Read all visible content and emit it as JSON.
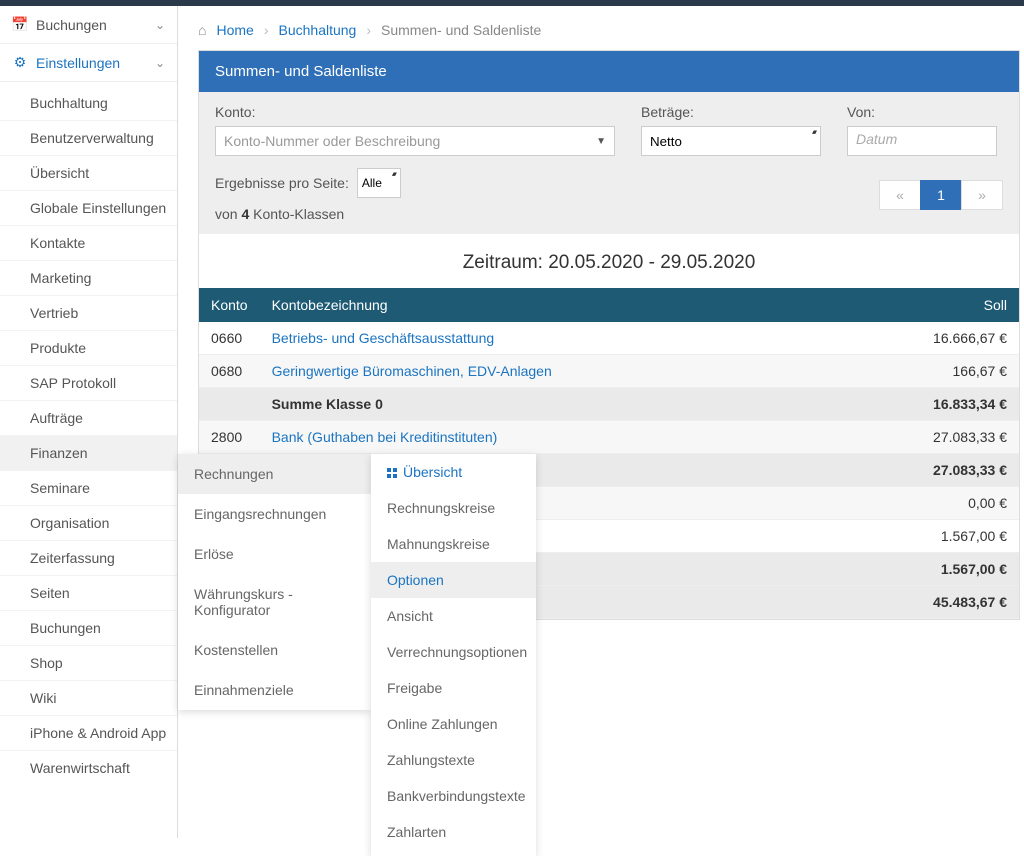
{
  "sidebar": {
    "sections": [
      {
        "label": "Buchungen",
        "icon": "📅"
      },
      {
        "label": "Einstellungen",
        "icon": "⚙"
      }
    ],
    "items": [
      "Buchhaltung",
      "Benutzerverwaltung",
      "Übersicht",
      "Globale Einstellungen",
      "Kontakte",
      "Marketing",
      "Vertrieb",
      "Produkte",
      "SAP Protokoll",
      "Aufträge",
      "Finanzen",
      "Seminare",
      "Organisation",
      "Zeiterfassung",
      "Seiten",
      "Buchungen",
      "Shop",
      "Wiki",
      "iPhone & Android App",
      "Warenwirtschaft"
    ],
    "active_item": "Finanzen"
  },
  "breadcrumb": [
    "Home",
    "Buchhaltung",
    "Summen- und Saldenliste"
  ],
  "panel": {
    "title": "Summen- und Saldenliste",
    "filter": {
      "konto_label": "Konto:",
      "konto_placeholder": "Konto-Nummer oder Beschreibung",
      "betraege_label": "Beträge:",
      "betraege_value": "Netto",
      "von_label": "Von:",
      "von_placeholder": "Datum",
      "rpp_label": "Ergebnisse pro Seite:",
      "rpp_value": "Alle",
      "results_prefix": "von ",
      "results_count": "4",
      "results_suffix": " Konto-Klassen",
      "pager": {
        "prev": "«",
        "current": "1",
        "next": "»"
      }
    },
    "period": "Zeitraum: 20.05.2020 - 29.05.2020",
    "columns": {
      "konto": "Konto",
      "name": "Kontobezeichnung",
      "soll": "Soll"
    },
    "rows": [
      {
        "konto": "0660",
        "name": "Betriebs- und Geschäftsausstattung",
        "soll": "16.666,67 €",
        "type": "data"
      },
      {
        "konto": "0680",
        "name": "Geringwertige Büromaschinen, EDV-Anlagen",
        "soll": "166,67 €",
        "type": "data"
      },
      {
        "konto": "",
        "name": "Summe Klasse 0",
        "soll": "16.833,34 €",
        "type": "sum"
      },
      {
        "konto": "2800",
        "name": "Bank (Guthaben bei Kreditinstituten)",
        "soll": "27.083,33 €",
        "type": "data"
      },
      {
        "konto": "",
        "name": "Summe Klasse 2",
        "soll": "27.083,33 €",
        "type": "sum"
      },
      {
        "konto": "",
        "name": "",
        "soll": "0,00 €",
        "type": "data",
        "hidden": true
      },
      {
        "konto": "",
        "name": "",
        "soll": "1.567,00 €",
        "type": "data",
        "hidden": true
      },
      {
        "konto": "",
        "name": "",
        "soll": "1.567,00 €",
        "type": "sum",
        "hidden": true
      },
      {
        "konto": "",
        "name": "",
        "soll": "45.483,67 €",
        "type": "sum",
        "hidden": true
      }
    ]
  },
  "flyout1": [
    "Rechnungen",
    "Eingangsrechnungen",
    "Erlöse",
    "Währungskurs - Konfigurator",
    "Kostenstellen",
    "Einnahmenziele"
  ],
  "flyout1_hover": "Rechnungen",
  "flyout2": [
    "Übersicht",
    "Rechnungskreise",
    "Mahnungskreise",
    "Optionen",
    "Ansicht",
    "Verrechnungsoptionen",
    "Freigabe",
    "Online Zahlungen",
    "Zahlungstexte",
    "Bankverbindungstexte",
    "Zahlarten"
  ],
  "flyout2_highlight": "Übersicht",
  "flyout2_hover": "Optionen"
}
